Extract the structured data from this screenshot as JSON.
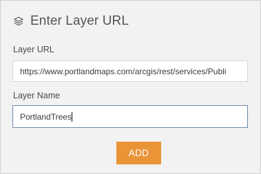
{
  "header": {
    "icon": "layers-icon",
    "title": "Enter Layer URL"
  },
  "form": {
    "layer_url": {
      "label": "Layer URL",
      "value": "https://www.portlandmaps.com/arcgis/rest/services/Publi"
    },
    "layer_name": {
      "label": "Layer Name",
      "value": "PortlandTrees"
    },
    "add_label": "ADD"
  },
  "colors": {
    "panel_background": "#f2f2f2",
    "accent_button": "#e99437",
    "focused_border": "#6d87a8"
  }
}
